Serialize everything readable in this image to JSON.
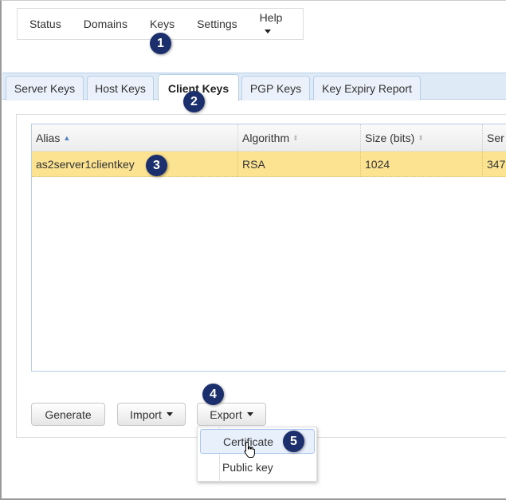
{
  "nav": {
    "items": [
      "Status",
      "Domains",
      "Keys",
      "Settings",
      "Help"
    ]
  },
  "tabs": [
    {
      "label": "Server Keys"
    },
    {
      "label": "Host Keys"
    },
    {
      "label": "Client Keys",
      "active": true
    },
    {
      "label": "PGP Keys"
    },
    {
      "label": "Key Expiry Report"
    }
  ],
  "table": {
    "columns": [
      "Alias",
      "Algorithm",
      "Size (bits)",
      "Ser"
    ],
    "sort": {
      "column": "Alias",
      "direction": "ascending"
    },
    "rows": [
      {
        "alias": "as2server1clientkey",
        "algorithm": "RSA",
        "size": "1024",
        "ser": "347",
        "selected": true
      }
    ]
  },
  "buttons": {
    "generate": "Generate",
    "import": "Import",
    "export": "Export"
  },
  "export_menu": {
    "items": [
      "Certificate",
      "Public key"
    ],
    "hovered": "Certificate"
  },
  "badges": [
    "1",
    "2",
    "3",
    "4",
    "5"
  ],
  "colors": {
    "badge": "#1b2f6c",
    "selected_row": "#fbe391",
    "tab_strip": "#dfeaf7"
  }
}
